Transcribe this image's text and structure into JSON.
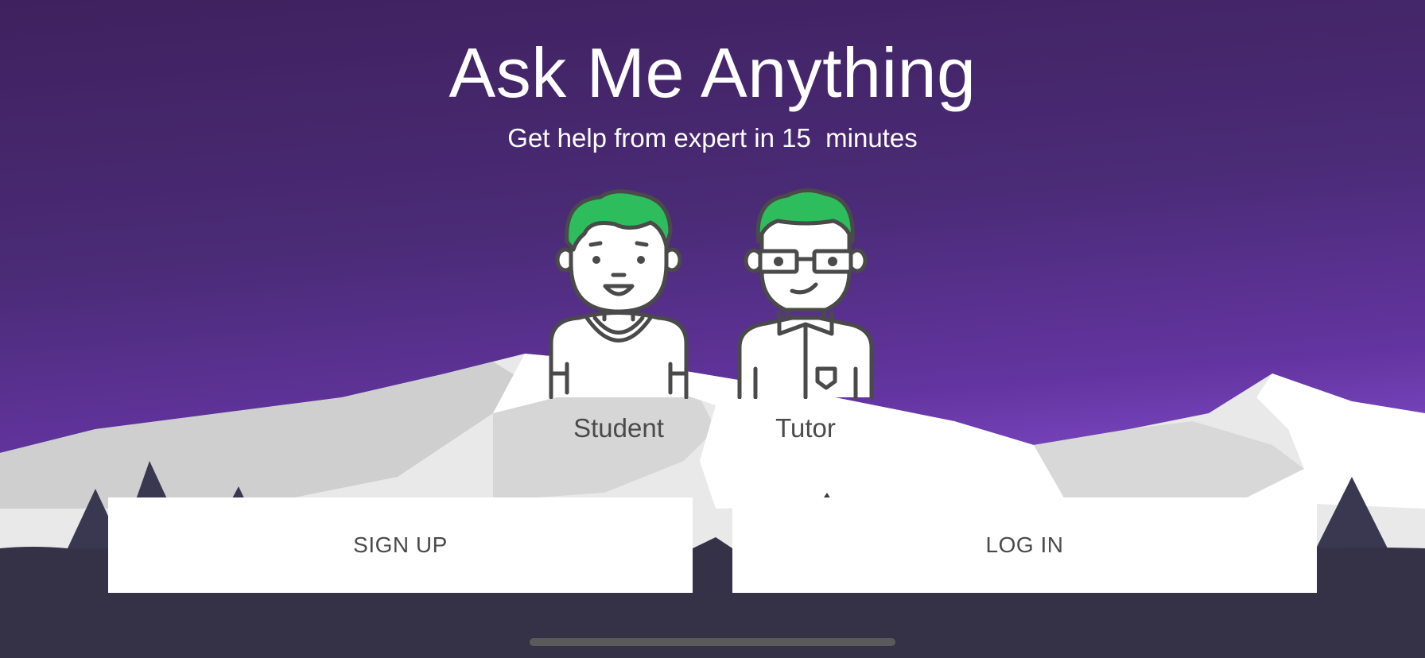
{
  "header": {
    "title": "Ask Me Anything",
    "subtitle": "Get help from expert in 15  minutes"
  },
  "roles": [
    {
      "label": "Student",
      "icon": "student-avatar-icon"
    },
    {
      "label": "Tutor",
      "icon": "tutor-avatar-icon"
    }
  ],
  "actions": {
    "signup_label": "SIGN UP",
    "login_label": "LOG IN"
  },
  "colors": {
    "background_top": "#3f215f",
    "background_bottom": "#7a47c0",
    "hair": "#2dbd5c",
    "outline": "#4a4a4a",
    "ground": "#353247"
  }
}
